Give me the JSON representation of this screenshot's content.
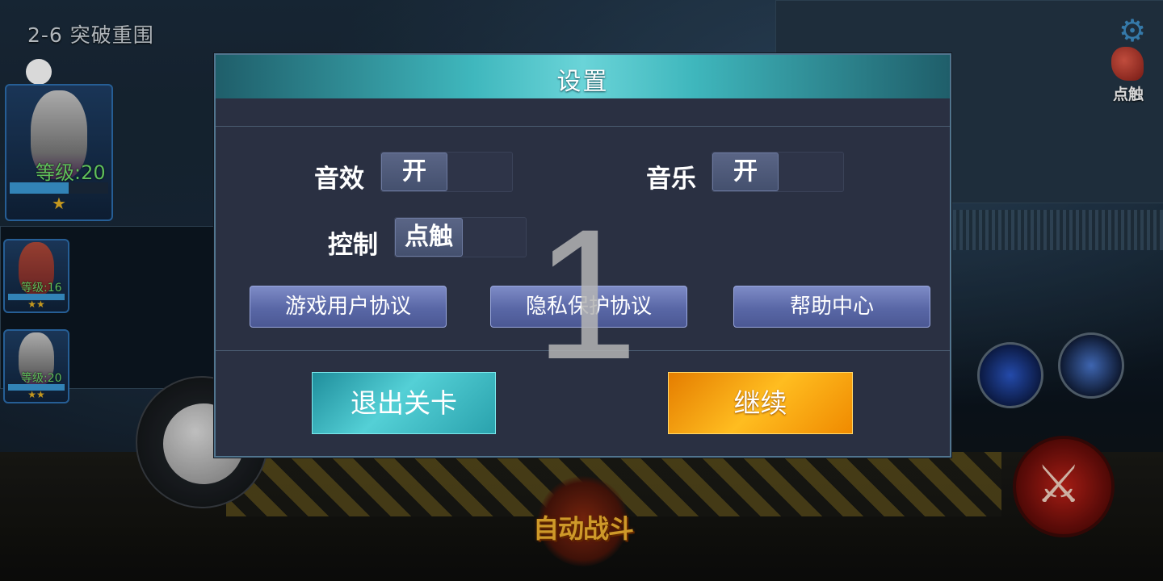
{
  "hud": {
    "stage_label": "2-6  突破重围",
    "touch_label": "点触",
    "auto_battle": "自动战斗"
  },
  "team": [
    {
      "level": "等级:20",
      "stars": "★",
      "hp": 0.6
    },
    {
      "level": "等级:16",
      "stars": "★★",
      "hp": 1.0
    },
    {
      "level": "等级:20",
      "stars": "★★",
      "hp": 1.0
    }
  ],
  "dialog": {
    "title": "设置",
    "sound_label": "音效",
    "sound_value": "开",
    "music_label": "音乐",
    "music_value": "开",
    "control_label": "控制",
    "control_value": "点触",
    "user_agreement": "游戏用户协议",
    "privacy_agreement": "隐私保护协议",
    "help_center": "帮助中心",
    "exit_level": "退出关卡",
    "continue": "继续"
  },
  "overlay_digit": "1",
  "colors": {
    "accent": "#3fb7bd",
    "continue": "#ffbd20",
    "exit": "#54d0d6"
  }
}
